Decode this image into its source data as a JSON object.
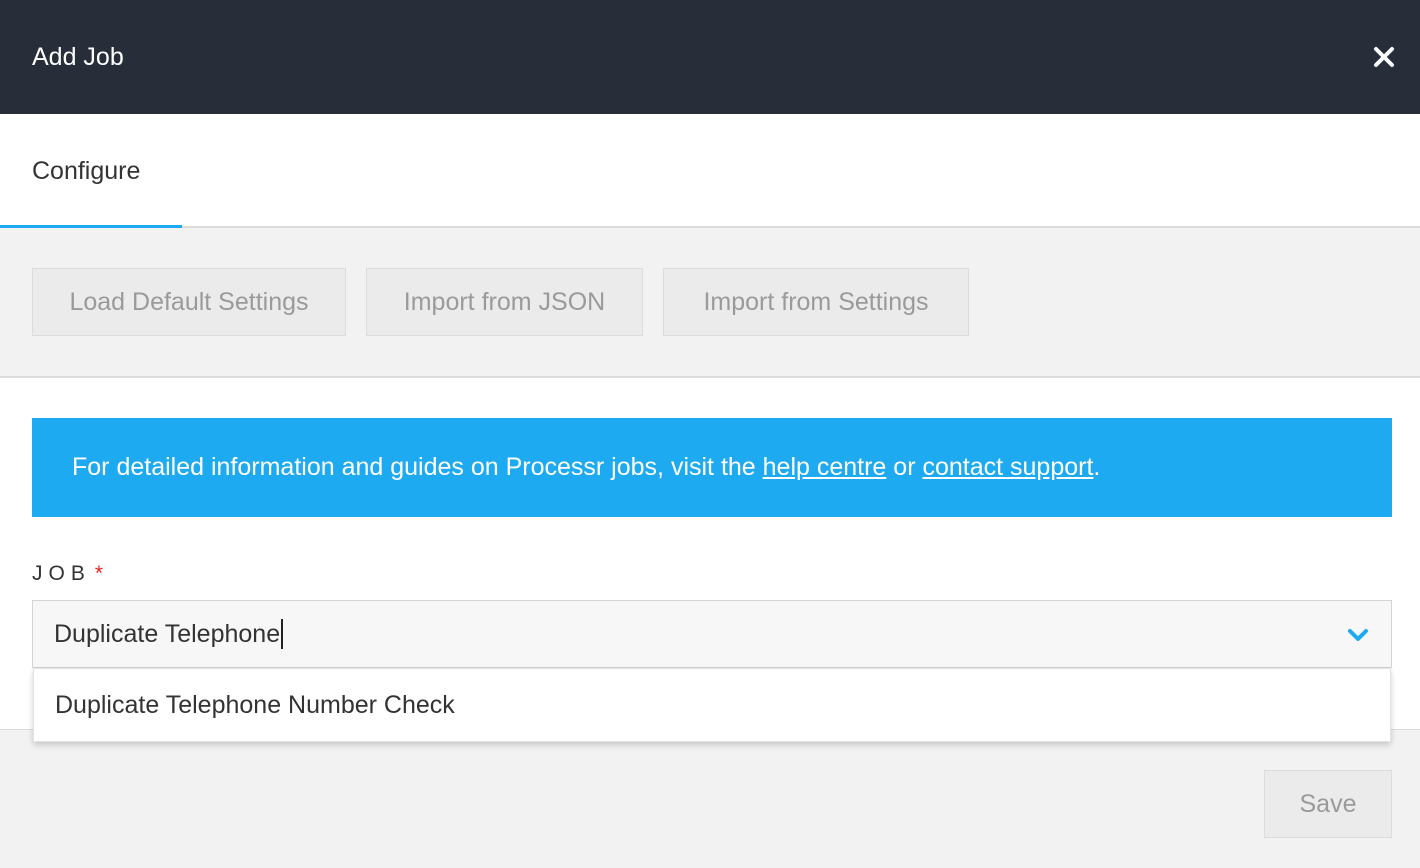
{
  "header": {
    "title": "Add Job",
    "close_icon": "close-icon"
  },
  "tabs": [
    {
      "label": "Configure",
      "active": true
    }
  ],
  "toolbar": {
    "load_default_label": "Load Default Settings",
    "import_json_label": "Import from JSON",
    "import_settings_label": "Import from Settings"
  },
  "info_banner": {
    "text_before": "For detailed information and guides on Processr jobs, visit the ",
    "help_link": "help centre",
    "text_middle": " or ",
    "support_link": "contact support",
    "text_after": "."
  },
  "job_field": {
    "label": "JOB",
    "required_marker": "*",
    "value": "Duplicate Telephone",
    "dropdown_icon": "chevron-down-icon",
    "options": [
      "Duplicate Telephone Number Check"
    ]
  },
  "footer": {
    "save_label": "Save"
  },
  "colors": {
    "header_bg": "#272d39",
    "accent": "#1eaaf1",
    "required": "#e02424"
  }
}
